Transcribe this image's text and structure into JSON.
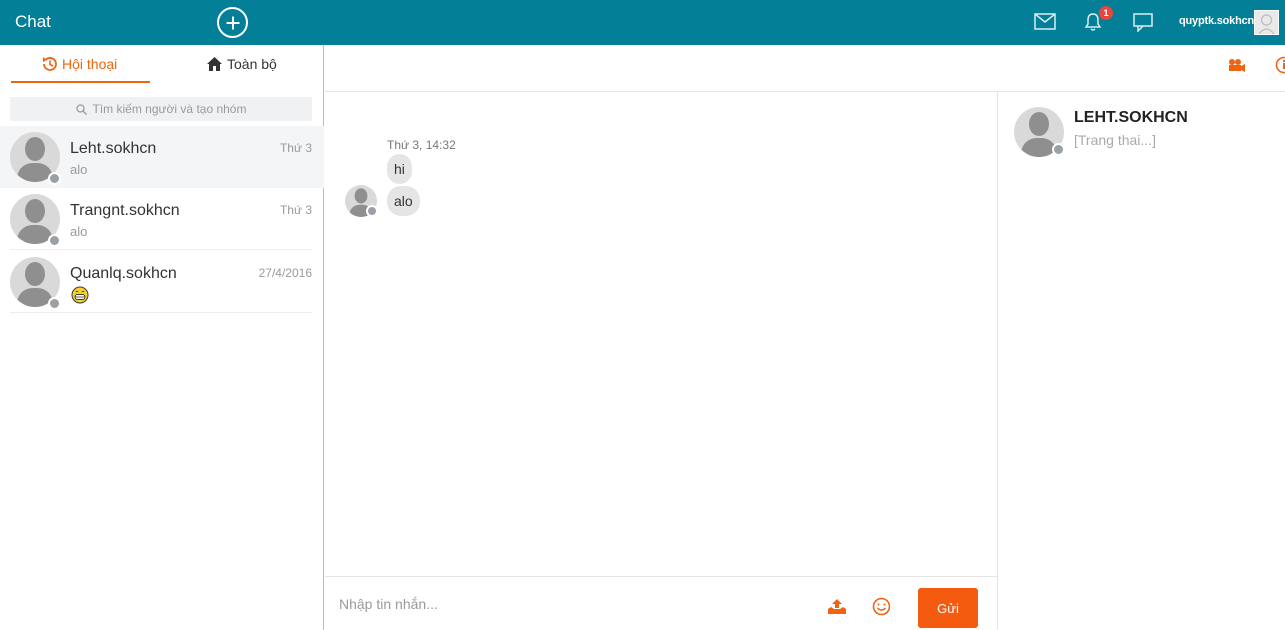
{
  "topbar": {
    "app_title": "Chat",
    "notification_count": "1",
    "username": "quyptk.sokhcn"
  },
  "sidebar": {
    "tabs": [
      {
        "label": "Hội thoại",
        "icon": "history-icon",
        "active": true
      },
      {
        "label": "Toàn bộ",
        "icon": "home-icon",
        "active": false
      }
    ],
    "search_placeholder": "Tìm kiếm người và tạo nhóm",
    "conversations": [
      {
        "name": "Leht.sokhcn",
        "preview": "alo",
        "time": "Thứ 3",
        "active": true
      },
      {
        "name": "Trangnt.sokhcn",
        "preview": "alo",
        "time": "Thứ 3",
        "active": false
      },
      {
        "name": "Quanlq.sokhcn",
        "preview_icon": "grinning-emoji",
        "time": "27/4/2016",
        "active": false
      }
    ]
  },
  "chat": {
    "timestamp": "Thứ 3, 14:32",
    "messages": [
      {
        "text": "hi"
      },
      {
        "text": "alo"
      }
    ],
    "composer_placeholder": "Nhập tin nhắn...",
    "send_label": "Gửi"
  },
  "profile": {
    "name": "LEHT.SOKHCN",
    "status": "[Trang thai...]"
  },
  "colors": {
    "topbar": "#037f97",
    "accent": "#f0630f",
    "send_button": "#f55b0e"
  }
}
